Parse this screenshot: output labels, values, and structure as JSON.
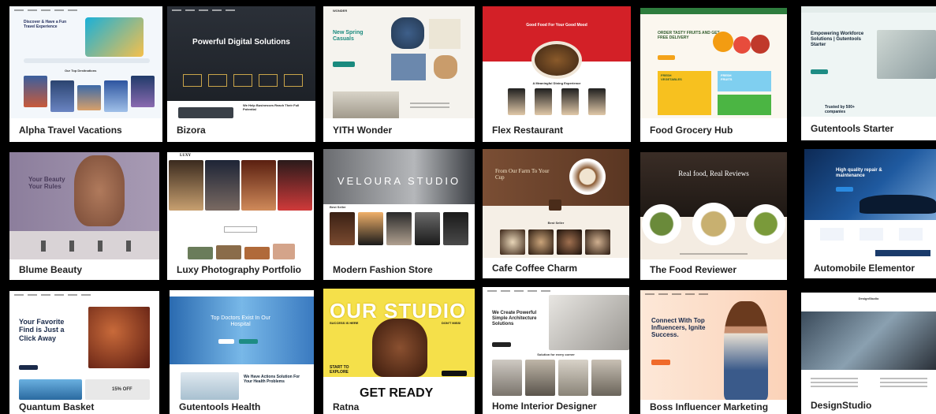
{
  "cards": [
    {
      "title": "Alpha Travel Vacations",
      "hero": "Discover & Have a Fun Travel Experience",
      "subhero": "Our Top Destinations"
    },
    {
      "title": "Bizora",
      "hero": "Powerful Digital Solutions",
      "subhero": "We Help Businesses Reach Their Full Potential"
    },
    {
      "title": "YITH Wonder",
      "hero": "New Spring Casuals",
      "logo": "WONDER"
    },
    {
      "title": "Flex Restaurant",
      "hero": "Good Food For Your Good Mood",
      "subhero": "A Meaningful Dining Experience"
    },
    {
      "title": "Food Grocery Hub",
      "hero": "ORDER TASTY FRUITS AND GET FREE DELIVERY",
      "promo1": "FRESH VEGETABLES",
      "promo2": "FRESH FRUITS"
    },
    {
      "title": "Gutentools Starter",
      "hero": "Empowering Workforce Solutions | Gutentools Starter",
      "stat": "Trusted by 500+ companies"
    },
    {
      "title": "Blume Beauty",
      "hero": "Your Beauty Your Rules"
    },
    {
      "title": "Luxy Photography Portfolio",
      "logo": "LUXY"
    },
    {
      "title": "Modern Fashion Store",
      "hero": "VELOURA STUDIO",
      "subhero": "Best Seller"
    },
    {
      "title": "Cafe Coffee Charm",
      "hero": "From Our Farm To Your Cup",
      "subhero": "Best Seller"
    },
    {
      "title": "The Food Reviewer",
      "hero": "Real food, Real Reviews"
    },
    {
      "title": "Automobile Elementor",
      "hero": "High quality repair & maintenance"
    },
    {
      "title": "Quantum Basket",
      "hero": "Your Favorite Find is Just a Click Away",
      "badge": "15% OFF"
    },
    {
      "title": "Gutentools Health",
      "hero": "Top Doctors Exist In Our Hospital",
      "subhero": "We Have Actions Solution For Your Health Problems"
    },
    {
      "title": "Ratna",
      "hero": "OUR STUDIO",
      "tag1": "SUCCESS IS HERE",
      "tag2": "DON'T MISS!",
      "sub": "START TO EXPLORE",
      "bottom": "GET READY"
    },
    {
      "title": "Home Interior Designer",
      "hero": "We Create Powerful Simple Architecture Solutions",
      "subhero": "Solution for every corner"
    },
    {
      "title": "Boss Influencer Marketing",
      "hero": "Connect With Top Influencers, Ignite Success."
    },
    {
      "title": "DesignStudio",
      "hero": "DesignStudio"
    }
  ],
  "colors": {
    "background": "#000000",
    "card": "#ffffff",
    "accent_green": "#2bb673",
    "accent_red": "#d32027",
    "accent_teal": "#1e8c84"
  }
}
